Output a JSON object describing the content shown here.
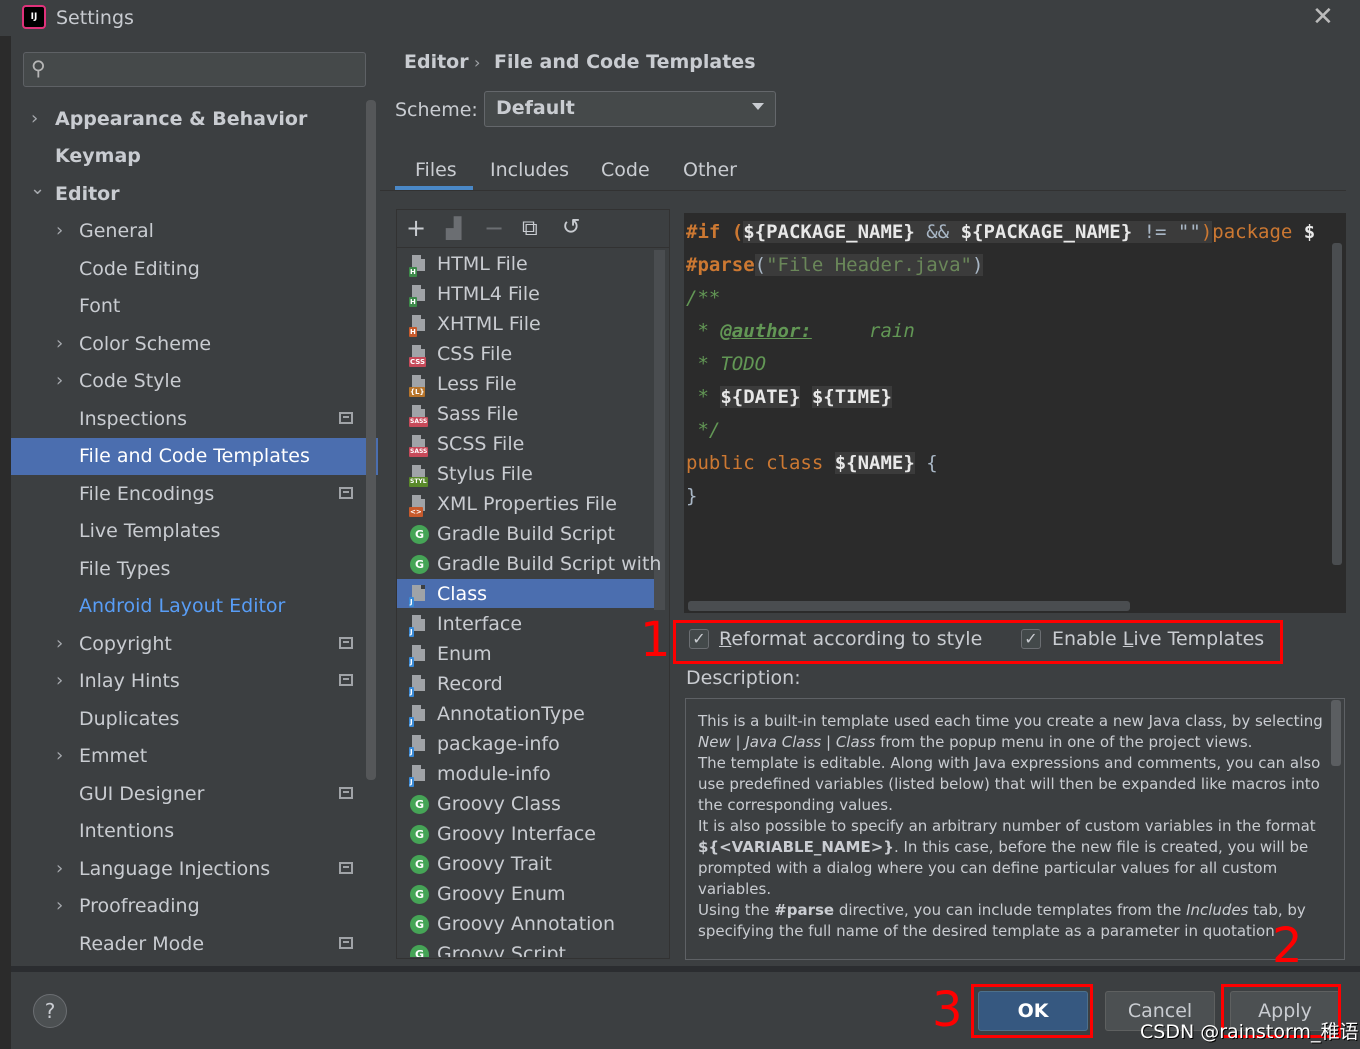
{
  "window": {
    "title": "Settings",
    "logo_text": "IJ",
    "close_glyph": "✕"
  },
  "search": {
    "placeholder": "",
    "icon": "search-icon"
  },
  "sidebar": {
    "items": [
      {
        "label": "Appearance & Behavior",
        "chevron": "›"
      },
      {
        "label": "Keymap"
      },
      {
        "label": "Editor",
        "chevron": "⌄"
      },
      {
        "label": "General",
        "chevron": "›"
      },
      {
        "label": "Code Editing"
      },
      {
        "label": "Font"
      },
      {
        "label": "Color Scheme",
        "chevron": "›"
      },
      {
        "label": "Code Style",
        "chevron": "›"
      },
      {
        "label": "Inspections"
      },
      {
        "label": "File and Code Templates",
        "selected": true
      },
      {
        "label": "File Encodings"
      },
      {
        "label": "Live Templates"
      },
      {
        "label": "File Types"
      },
      {
        "label": "Android Layout Editor",
        "link_color": "#589df6"
      },
      {
        "label": "Copyright",
        "chevron": "›"
      },
      {
        "label": "Inlay Hints",
        "chevron": "›"
      },
      {
        "label": "Duplicates"
      },
      {
        "label": "Emmet",
        "chevron": "›"
      },
      {
        "label": "GUI Designer"
      },
      {
        "label": "Intentions"
      },
      {
        "label": "Language Injections",
        "chevron": "›"
      },
      {
        "label": "Proofreading",
        "chevron": "›"
      },
      {
        "label": "Reader Mode"
      }
    ]
  },
  "breadcrumb": {
    "part1": "Editor",
    "separator": "›",
    "part2": "File and Code Templates"
  },
  "scheme": {
    "label": "Scheme:",
    "value": "Default"
  },
  "tabs": [
    {
      "label": "Files",
      "active": true
    },
    {
      "label": "Includes"
    },
    {
      "label": "Code"
    },
    {
      "label": "Other"
    }
  ],
  "toolbar": {
    "add": "+",
    "copy": "⧉",
    "remove": "−",
    "reset": "↺"
  },
  "templates": [
    {
      "label": "HTML File",
      "badge": "H"
    },
    {
      "label": "HTML4 File",
      "badge": "H"
    },
    {
      "label": "XHTML File",
      "badge": "H"
    },
    {
      "label": "CSS File",
      "badge": "CSS"
    },
    {
      "label": "Less File",
      "badge": "{L}"
    },
    {
      "label": "Sass File",
      "badge": "SASS"
    },
    {
      "label": "SCSS File",
      "badge": "SASS"
    },
    {
      "label": "Stylus File",
      "badge": "STYL"
    },
    {
      "label": "XML Properties File",
      "badge": "<>"
    },
    {
      "label": "Gradle Build Script",
      "badge": "G"
    },
    {
      "label": "Gradle Build Script with wr",
      "badge": "G"
    },
    {
      "label": "Class",
      "badge": "J",
      "selected": true
    },
    {
      "label": "Interface",
      "badge": "J"
    },
    {
      "label": "Enum",
      "badge": "J"
    },
    {
      "label": "Record",
      "badge": "J"
    },
    {
      "label": "AnnotationType",
      "badge": "J"
    },
    {
      "label": "package-info",
      "badge": "J"
    },
    {
      "label": "module-info",
      "badge": "J"
    },
    {
      "label": "Groovy Class",
      "badge": "G"
    },
    {
      "label": "Groovy Interface",
      "badge": "G"
    },
    {
      "label": "Groovy Trait",
      "badge": "G"
    },
    {
      "label": "Groovy Enum",
      "badge": "G"
    },
    {
      "label": "Groovy Annotation",
      "badge": "G"
    },
    {
      "label": "Groovy Script",
      "badge": "G"
    }
  ],
  "editor": {
    "l1_a": "#if (",
    "l1_b": "${PACKAGE_NAME}",
    "l1_c": " && ",
    "l1_d": "${PACKAGE_NAME}",
    "l1_e": " != ",
    "l1_f": "\"\"",
    "l1_g": ")",
    "l1_h": "package ",
    "l1_i": "$",
    "l2_a": "#parse",
    "l2_b": "(",
    "l2_c": "\"File Header.java\"",
    "l2_d": ")",
    "l3": "/**",
    "l4_a": " * ",
    "l4_b": "@author:",
    "l4_c": "     rain",
    "l5": " * TODO",
    "l6_a": " * ",
    "l6_b": "${DATE}",
    "l6_c": " ",
    "l6_d": "${TIME}",
    "l7": " */",
    "l8_a": "public class ",
    "l8_b": "${NAME}",
    "l8_c": " {",
    "l9": "}"
  },
  "options": {
    "reformat": {
      "checked": true,
      "label_pre": "",
      "label_u": "R",
      "label_post": "eformat according to style"
    },
    "live_templates": {
      "checked": true,
      "label_pre": "Enable ",
      "label_u": "L",
      "label_post": "ive Templates"
    }
  },
  "description": {
    "label": "Description:",
    "p1_a": "This is a built-in template used each time you create a new Java class, by selecting ",
    "p1_b": "New",
    "p1_c": " | ",
    "p1_d": "Java Class",
    "p1_e": " | ",
    "p1_f": "Class",
    "p1_g": " from the popup menu in one of the project views.",
    "p2": "The template is editable. Along with Java expressions and comments, you can also use predefined variables (listed below) that will then be expanded like macros into the corresponding values.",
    "p3_a": "It is also possible to specify an arbitrary number of custom variables in the format ",
    "p3_b": "${<VARIABLE_NAME>}",
    "p3_c": ". In this case, before the new file is created, you will be prompted with a dialog where you can define particular values for all custom variables.",
    "p4_a": "Using the ",
    "p4_b": "#parse",
    "p4_c": " directive, you can include templates from the ",
    "p4_d": "Includes",
    "p4_e": " tab, by specifying the full name of the desired template as a parameter in quotation"
  },
  "buttons": {
    "help": "?",
    "ok": "OK",
    "cancel": "Cancel",
    "apply": "Apply"
  },
  "annotations": {
    "n1": "1",
    "n2": "2",
    "n3": "3"
  },
  "watermark": "CSDN @rainstorm_稚语",
  "colors": {
    "accent": "#4b6eaf",
    "annotation_red": "#ff0000",
    "keyword": "#cc7832",
    "string": "#6a8759",
    "comment": "#629755"
  }
}
